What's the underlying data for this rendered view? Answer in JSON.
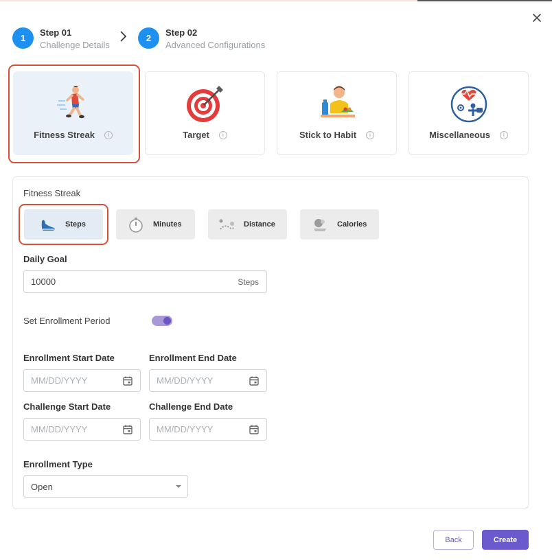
{
  "stepper": {
    "steps": [
      {
        "number": "1",
        "title": "Step 01",
        "subtitle": "Challenge Details"
      },
      {
        "number": "2",
        "title": "Step 02",
        "subtitle": "Advanced Configurations"
      }
    ]
  },
  "categories": [
    {
      "label": "Fitness Streak",
      "icon": "runner-icon",
      "selected": true
    },
    {
      "label": "Target",
      "icon": "target-icon",
      "selected": false
    },
    {
      "label": "Stick to Habit",
      "icon": "habit-icon",
      "selected": false
    },
    {
      "label": "Miscellaneous",
      "icon": "misc-icon",
      "selected": false
    }
  ],
  "info_glyph": "i",
  "panel": {
    "section_title": "Fitness Streak",
    "metrics": [
      {
        "label": "Steps",
        "icon": "shoe-icon",
        "selected": true
      },
      {
        "label": "Minutes",
        "icon": "stopwatch-icon",
        "selected": false
      },
      {
        "label": "Distance",
        "icon": "distance-icon",
        "selected": false
      },
      {
        "label": "Calories",
        "icon": "calories-icon",
        "selected": false
      }
    ],
    "daily_goal": {
      "label": "Daily Goal",
      "value": "10000",
      "unit": "Steps"
    },
    "enrollment_period": {
      "label": "Set Enrollment Period",
      "enabled": true
    },
    "dates": {
      "enrollment_start": {
        "label": "Enrollment Start Date",
        "placeholder": "MM/DD/YYYY"
      },
      "enrollment_end": {
        "label": "Enrollment End Date",
        "placeholder": "MM/DD/YYYY"
      },
      "challenge_start": {
        "label": "Challenge Start Date",
        "placeholder": "MM/DD/YYYY"
      },
      "challenge_end": {
        "label": "Challenge End Date",
        "placeholder": "MM/DD/YYYY"
      }
    },
    "enrollment_type": {
      "label": "Enrollment Type",
      "value": "Open"
    }
  },
  "footer": {
    "back_label": "Back",
    "create_label": "Create"
  },
  "colors": {
    "accent": "#6a5acd",
    "step_blue": "#1e90f0",
    "highlight": "#d6503b",
    "selected_bg": "#eaf1f8"
  }
}
